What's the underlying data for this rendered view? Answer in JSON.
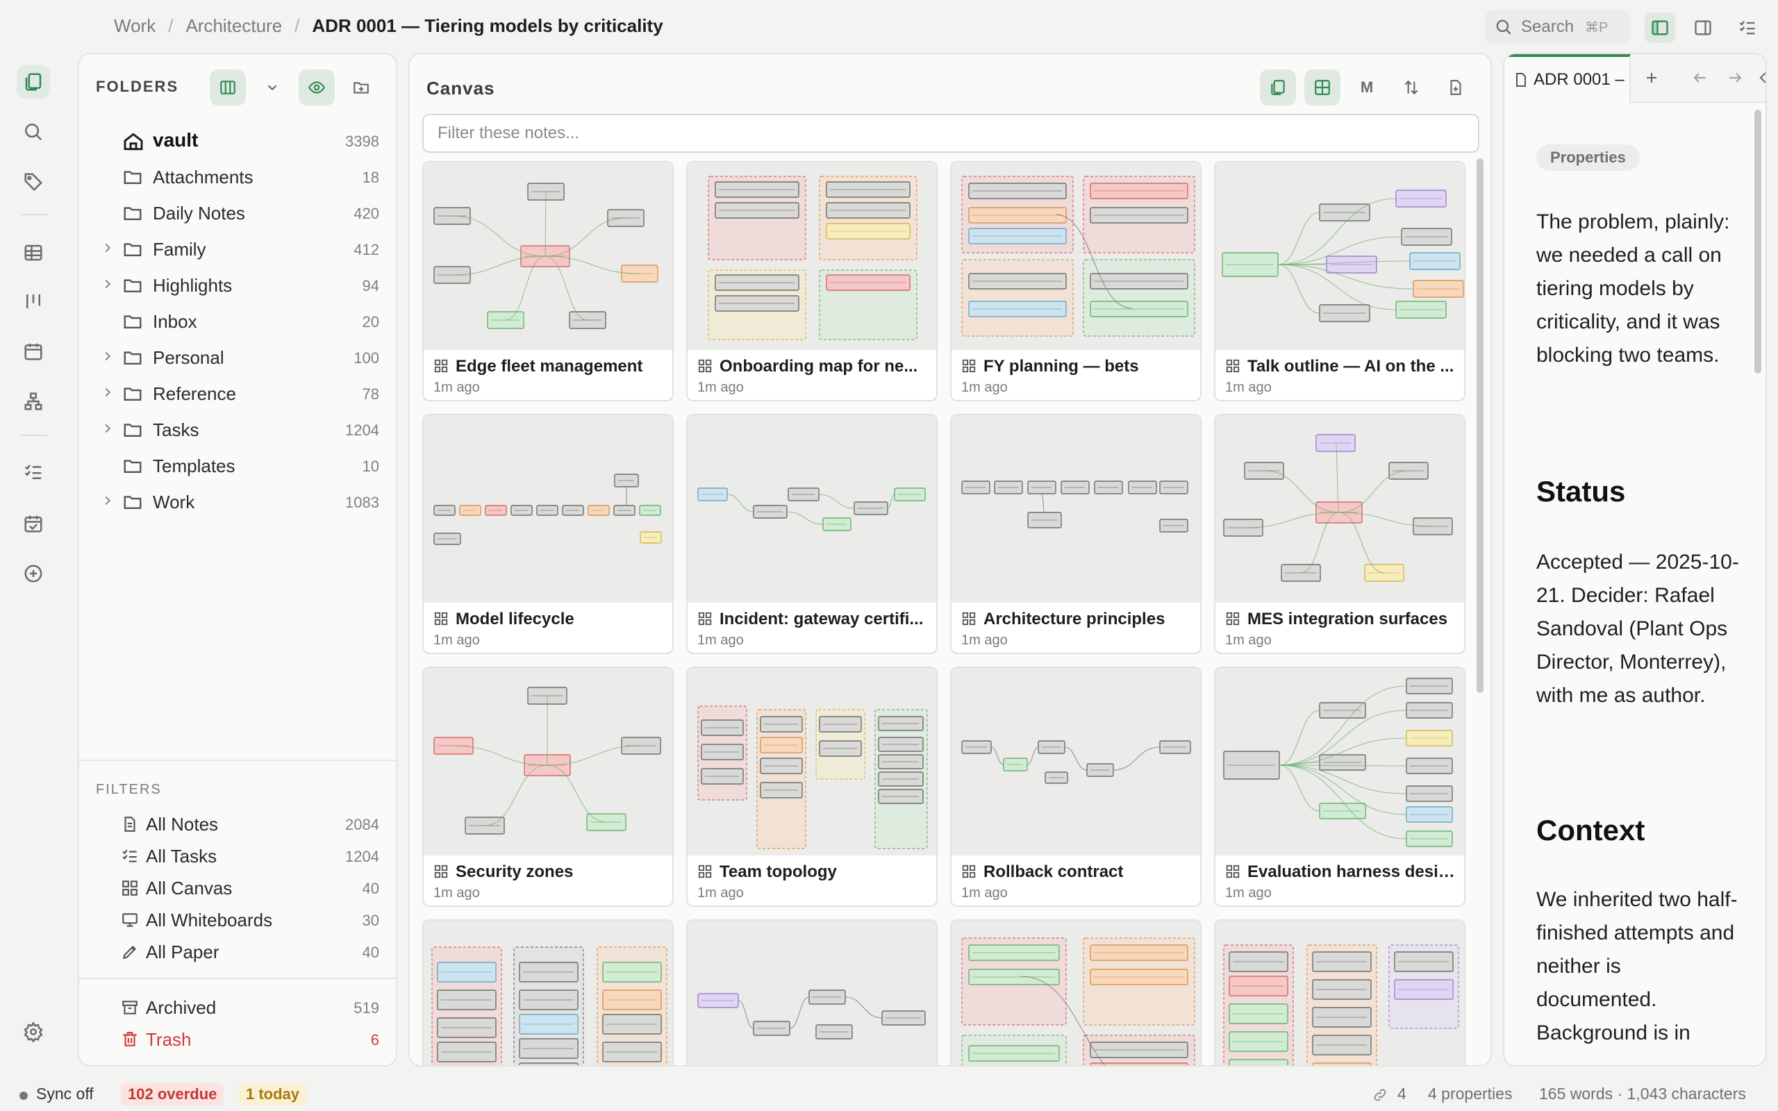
{
  "breadcrumb": {
    "items": [
      "Work",
      "Architecture"
    ],
    "current": "ADR 0001 — Tiering models by criticality",
    "separator": "/"
  },
  "search": {
    "label": "Search",
    "shortcut": "⌘P"
  },
  "folders": {
    "title": "FOLDERS",
    "root": {
      "name": "vault",
      "count": "3398"
    },
    "items": [
      {
        "name": "Attachments",
        "count": "18",
        "expandable": false
      },
      {
        "name": "Daily Notes",
        "count": "420",
        "expandable": false
      },
      {
        "name": "Family",
        "count": "412",
        "expandable": true
      },
      {
        "name": "Highlights",
        "count": "94",
        "expandable": true
      },
      {
        "name": "Inbox",
        "count": "20",
        "expandable": false
      },
      {
        "name": "Personal",
        "count": "100",
        "expandable": true
      },
      {
        "name": "Reference",
        "count": "78",
        "expandable": true
      },
      {
        "name": "Tasks",
        "count": "1204",
        "expandable": true
      },
      {
        "name": "Templates",
        "count": "10",
        "expandable": false
      },
      {
        "name": "Work",
        "count": "1083",
        "expandable": true
      }
    ]
  },
  "filters": {
    "title": "FILTERS",
    "items": [
      {
        "name": "All Notes",
        "count": "2084",
        "icon": "note-icon"
      },
      {
        "name": "All Tasks",
        "count": "1204",
        "icon": "tasks-icon"
      },
      {
        "name": "All Canvas",
        "count": "40",
        "icon": "canvas-icon"
      },
      {
        "name": "All Whiteboards",
        "count": "30",
        "icon": "whiteboard-icon"
      },
      {
        "name": "All Paper",
        "count": "40",
        "icon": "pen-icon"
      }
    ],
    "archived": {
      "name": "Archived",
      "count": "519"
    },
    "trash": {
      "name": "Trash",
      "count": "6"
    }
  },
  "canvas": {
    "title": "Canvas",
    "view_toggle_label": "M",
    "filter_placeholder": "Filter these notes...",
    "cards": [
      {
        "title": "Edge fleet management",
        "time": "1m ago",
        "thumb": "mind"
      },
      {
        "title": "Onboarding map for ne...",
        "time": "1m ago",
        "thumb": "retro"
      },
      {
        "title": "FY planning — bets",
        "time": "1m ago",
        "thumb": "matrix"
      },
      {
        "title": "Talk outline — AI on the ...",
        "time": "1m ago",
        "thumb": "tree"
      },
      {
        "title": "Model lifecycle",
        "time": "1m ago",
        "thumb": "pipeline"
      },
      {
        "title": "Incident: gateway certifi...",
        "time": "1m ago",
        "thumb": "flow"
      },
      {
        "title": "Architecture principles",
        "time": "1m ago",
        "thumb": "row"
      },
      {
        "title": "MES integration surfaces",
        "time": "1m ago",
        "thumb": "mind2"
      },
      {
        "title": "Security zones",
        "time": "1m ago",
        "thumb": "mind3"
      },
      {
        "title": "Team topology",
        "time": "1m ago",
        "thumb": "columns"
      },
      {
        "title": "Rollback contract",
        "time": "1m ago",
        "thumb": "flow2"
      },
      {
        "title": "Evaluation harness design",
        "time": "1m ago",
        "thumb": "tree2"
      },
      {
        "title": "",
        "time": "",
        "thumb": "kanban"
      },
      {
        "title": "",
        "time": "",
        "thumb": "flow3"
      },
      {
        "title": "",
        "time": "",
        "thumb": "retro2"
      },
      {
        "title": "",
        "time": "",
        "thumb": "kanban2"
      }
    ]
  },
  "note": {
    "tab_title": "ADR 0001 –",
    "properties_label": "Properties",
    "intro": "The problem, plainly: we needed a call on tiering models by criticality, and it was blocking two teams.",
    "status_heading": "Status",
    "status_text": "Accepted — 2025-10-21. Decider: Rafael Sandoval (Plant Ops Director, Monterrey), with me as author.",
    "context_heading": "Context",
    "context_text": "We inherited two half-finished attempts and neither is documented. Background is in"
  },
  "status": {
    "sync": "Sync off",
    "overdue": "102 overdue",
    "today": "1 today",
    "links": "4",
    "properties": "4 properties",
    "words": "165 words · 1,043 characters"
  },
  "colors": {
    "accent": "#2f8a55",
    "danger": "#d43a3a",
    "warning": "#a67a10"
  }
}
